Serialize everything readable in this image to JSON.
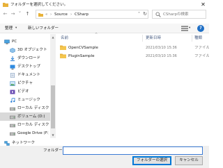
{
  "window": {
    "title": "フォルダーを選択してください。",
    "close_glyph": "✕"
  },
  "address": {
    "back_glyph": "←",
    "forward_glyph": "→",
    "up_glyph": "↑",
    "recent_glyph": "˅",
    "segments": [
      "Source",
      "CSharp"
    ],
    "separator": "›",
    "leading_sep": "«",
    "dropdown_glyph": "˅",
    "refresh_glyph": "↻"
  },
  "search": {
    "placeholder": "CSharpの検索"
  },
  "toolbar": {
    "organize_label": "整理",
    "new_folder_label": "新しいフォルダー",
    "chevron": "▾",
    "help_glyph": "?"
  },
  "nav": {
    "items": [
      {
        "label": "PC",
        "icon": "pc-icon",
        "level": "top"
      },
      {
        "label": "3D オブジェクト",
        "icon": "3d-objects-icon",
        "level": "sub"
      },
      {
        "label": "ダウンロード",
        "icon": "download-icon",
        "level": "sub"
      },
      {
        "label": "デスクトップ",
        "icon": "desktop-icon",
        "level": "sub"
      },
      {
        "label": "ドキュメント",
        "icon": "documents-icon",
        "level": "sub"
      },
      {
        "label": "ピクチャ",
        "icon": "pictures-icon",
        "level": "sub"
      },
      {
        "label": "ビデオ",
        "icon": "videos-icon",
        "level": "sub"
      },
      {
        "label": "ミュージック",
        "icon": "music-icon",
        "level": "sub"
      },
      {
        "label": "ローカル ディスク (C",
        "icon": "drive-icon",
        "level": "sub"
      },
      {
        "label": "ボリューム (D:)",
        "icon": "drive-icon",
        "level": "sub",
        "selected": true
      },
      {
        "label": "ローカル ディスク (E",
        "icon": "drive-icon",
        "level": "sub"
      },
      {
        "label": "Google Drive (F:)",
        "icon": "drive-icon",
        "level": "sub"
      },
      {
        "label": "ネットワーク",
        "icon": "network-icon",
        "level": "top"
      }
    ],
    "scroll_up": "▲",
    "scroll_down": "▼"
  },
  "filelist": {
    "columns": {
      "name": "名前",
      "modified": "更新日時",
      "type": "種類"
    },
    "sort_glyph": "^",
    "rows": [
      {
        "name": "OpenCVSample",
        "modified": "2021/03/10 15:36",
        "type": "ファイル"
      },
      {
        "name": "PluginSample",
        "modified": "2021/03/10 15:36",
        "type": "ファイル"
      }
    ]
  },
  "footer": {
    "folder_label": "フォルダー:",
    "folder_value": "",
    "select_button": "フォルダーの選択",
    "cancel_button": "キャンセル"
  },
  "colors": {
    "accent": "#0078d7",
    "folder": "#e8b23a",
    "selection": "#d9d9d9"
  }
}
